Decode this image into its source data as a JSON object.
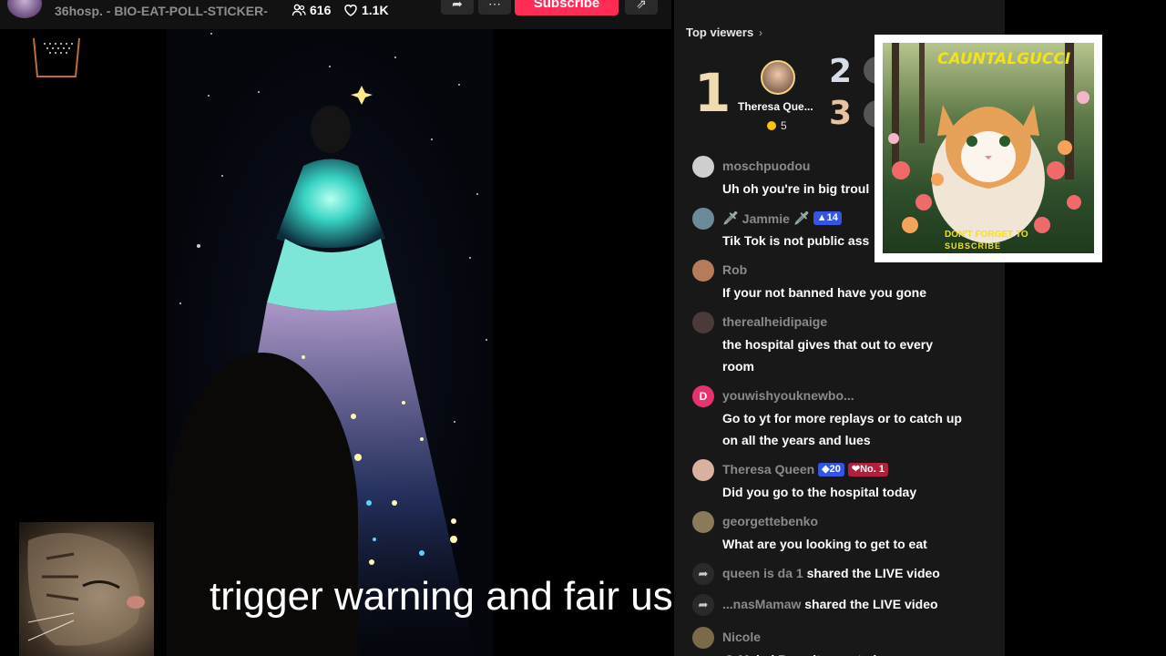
{
  "header": {
    "title": "36hosp. - BIO-EAT-POLL-STICKER-",
    "viewers": "616",
    "likes": "1.1K",
    "subscribe_label": "Subscribe",
    "icons": {
      "viewers": "people-icon",
      "likes": "heart-icon",
      "share": "share-arrow-icon",
      "more": "more-dots-icon",
      "collapse": "collapse-icon"
    }
  },
  "stream": {
    "subtitle": "trigger warning and fair use"
  },
  "top_viewers": {
    "label": "Top viewers",
    "ranks": [
      {
        "rank": "1",
        "name": "Theresa Que...",
        "coins": "5"
      },
      {
        "rank": "2"
      },
      {
        "rank": "3"
      }
    ]
  },
  "chat": {
    "messages": [
      {
        "user": "moschpuodou",
        "text": "Uh oh you're in big troul",
        "avatar_color": "#cfcfcf"
      },
      {
        "user": "Jammie",
        "badge": "14",
        "text": "Tik Tok is not public ass",
        "avatar_color": "#6d8a9a"
      },
      {
        "user": "Rob",
        "text": "If your not banned have you gone",
        "avatar_color": "#b57b5a"
      },
      {
        "user": "therealheidipaige",
        "text": "the hospital gives that out to every room",
        "avatar_color": "#4a3a3a"
      },
      {
        "user": "youwishyouknewbo...",
        "avatar_letter": "D",
        "text": "Go to yt for more replays or to catch up on all the years and lues",
        "avatar_color": "#e8326e"
      },
      {
        "user": "Theresa Queen",
        "badge": "20",
        "badge2": "No. 1",
        "text": "Did you go to the hospital today",
        "avatar_color": "#d9b1a0"
      },
      {
        "user": "georgettebenko",
        "text": "What are you looking to get to eat",
        "avatar_color": "#8a7a5a"
      }
    ],
    "shared": [
      {
        "who": "queen is da 1",
        "what": "shared the LIVE video"
      },
      {
        "who": "...nasMamaw",
        "what": "shared the LIVE video"
      }
    ],
    "last": {
      "user": "Nicole",
      "text": "@ Mabel Rose it goes to her",
      "avatar_color": "#7a6a4a"
    }
  },
  "promo": {
    "brand": "CAUNTALGUCCI",
    "cta_line1": "DON'T FORGET TO",
    "cta_line2": "SUBSCRIBE"
  },
  "colors": {
    "accent": "#fe2c55",
    "panel_bg": "#181818",
    "badge_blue": "#3554e4",
    "badge_red": "#b3203d"
  }
}
